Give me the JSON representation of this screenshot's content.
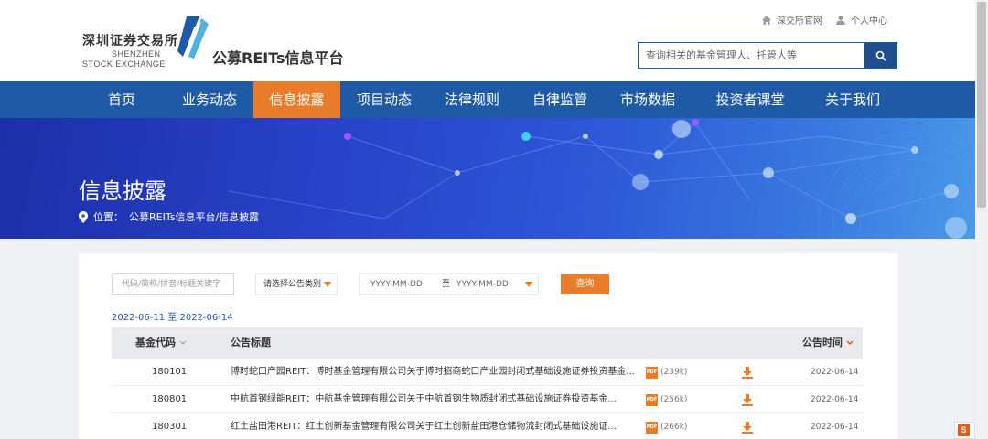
{
  "header": {
    "logo_cn": "深圳证券交易所",
    "logo_en_line1": "SHENZHEN",
    "logo_en_line2": "STOCK EXCHANGE",
    "platform_title": "公募REITs信息平台",
    "links": [
      {
        "label": "深交所官网",
        "icon": "home-icon"
      },
      {
        "label": "个人中心",
        "icon": "user-icon"
      }
    ],
    "search_placeholder": "查询相关的基金管理人、托管人等"
  },
  "nav": {
    "items": [
      {
        "label": "首页",
        "active": false
      },
      {
        "label": "业务动态",
        "active": false
      },
      {
        "label": "信息披露",
        "active": true
      },
      {
        "label": "项目动态",
        "active": false
      },
      {
        "label": "法律规则",
        "active": false
      },
      {
        "label": "自律监管",
        "active": false
      },
      {
        "label": "市场数据",
        "active": false
      },
      {
        "label": "投资者课堂",
        "active": false
      },
      {
        "label": "关于我们",
        "active": false
      }
    ]
  },
  "banner": {
    "title": "信息披露",
    "breadcrumb_label": "位置：",
    "breadcrumb_path": "公募REITs信息平台/信息披露"
  },
  "filters": {
    "code_placeholder": "代码/简称/拼音/标题关键字",
    "type_select": "请选择公告类别",
    "date_start": "YYYY-MM-DD",
    "date_sep": "至",
    "date_end": "YYYY-MM-DD",
    "query_button": "查询"
  },
  "date_range": "2022-06-11 至 2022-06-14",
  "table": {
    "headers": {
      "code": "基金代码",
      "title": "公告标题",
      "time": "公告时间"
    },
    "rows": [
      {
        "code": "180101",
        "title": "博时蛇口产园REIT：博时基金管理有限公司关于博时招商蛇口产业园封闭式基础设施证券投资基金...",
        "size": "(239k)",
        "date": "2022-06-14"
      },
      {
        "code": "180801",
        "title": "中航首钢绿能REIT：中航基金管理有限公司关于中航首钢生物质封闭式基础设施证券投资基金...",
        "size": "(256k)",
        "date": "2022-06-14"
      },
      {
        "code": "180301",
        "title": "红土盐田港REIT：红土创新基金管理有限公司关于红土创新盐田港仓储物流封闭式基础设施证...",
        "size": "(266k)",
        "date": "2022-06-14"
      }
    ]
  },
  "colors": {
    "nav_blue": "#1f5aa6",
    "accent_orange": "#e87c2a"
  }
}
